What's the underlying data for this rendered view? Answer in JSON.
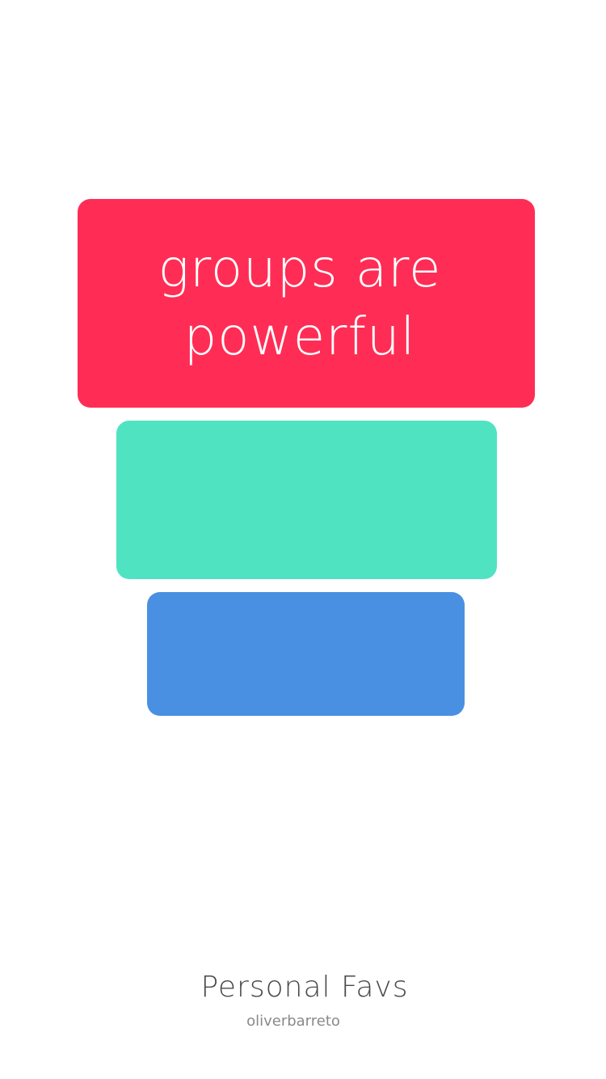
{
  "cards": {
    "primary": {
      "line1": "groups are",
      "line2": "powerful",
      "color": "#FF2D55"
    },
    "secondary": {
      "color": "#50E3C2"
    },
    "tertiary": {
      "color": "#4A90E2"
    }
  },
  "footer": {
    "title": "Personal Favs",
    "subtitle": "oliverbarreto"
  }
}
